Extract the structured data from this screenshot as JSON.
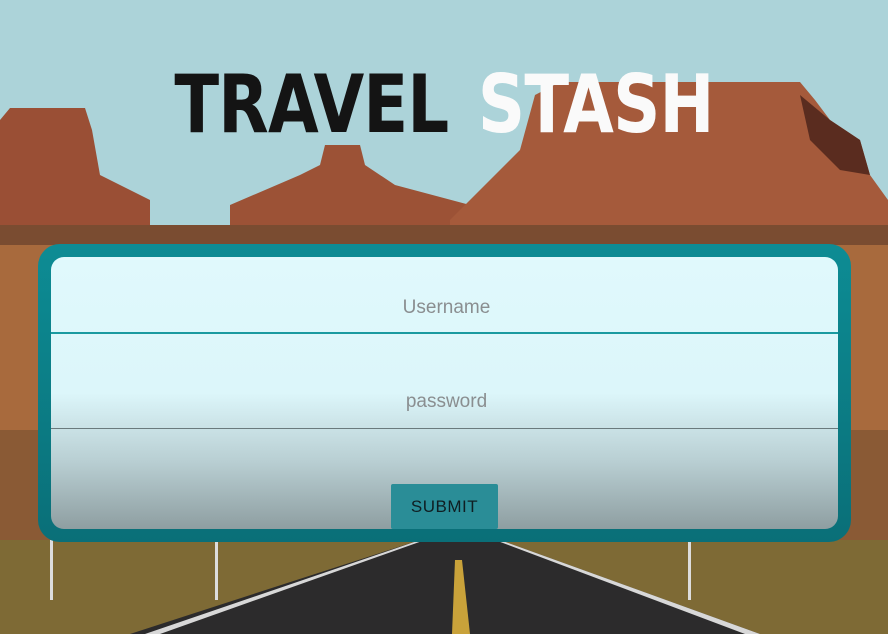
{
  "header": {
    "title_word1": "TRAVEL",
    "title_word2": "STASH"
  },
  "login": {
    "username_placeholder": "Username",
    "password_placeholder": "password",
    "submit_label": "SUBMIT"
  },
  "colors": {
    "panel_border": "#0d8c94",
    "submit_bg": "#2a8d97"
  }
}
